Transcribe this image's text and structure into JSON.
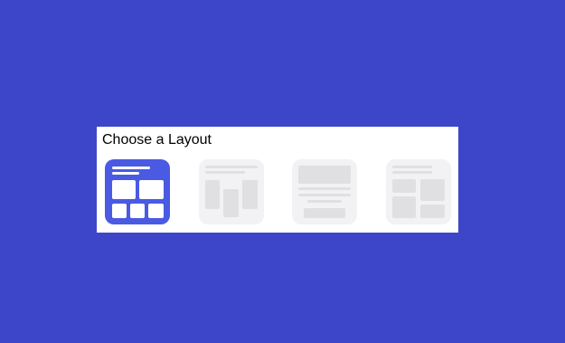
{
  "dialog": {
    "title": "Choose a Layout"
  },
  "colors": {
    "background": "#3d46c9",
    "panel": "#ffffff",
    "selected_tile": "#4a5ae3",
    "unselected_tile": "#f2f2f4",
    "placeholder_block": "#e0e0e2"
  },
  "layouts": [
    {
      "icon": "grid-layout-icon",
      "selected": true
    },
    {
      "icon": "three-column-layout-icon",
      "selected": false
    },
    {
      "icon": "hero-text-layout-icon",
      "selected": false
    },
    {
      "icon": "mosaic-layout-icon",
      "selected": false
    }
  ]
}
